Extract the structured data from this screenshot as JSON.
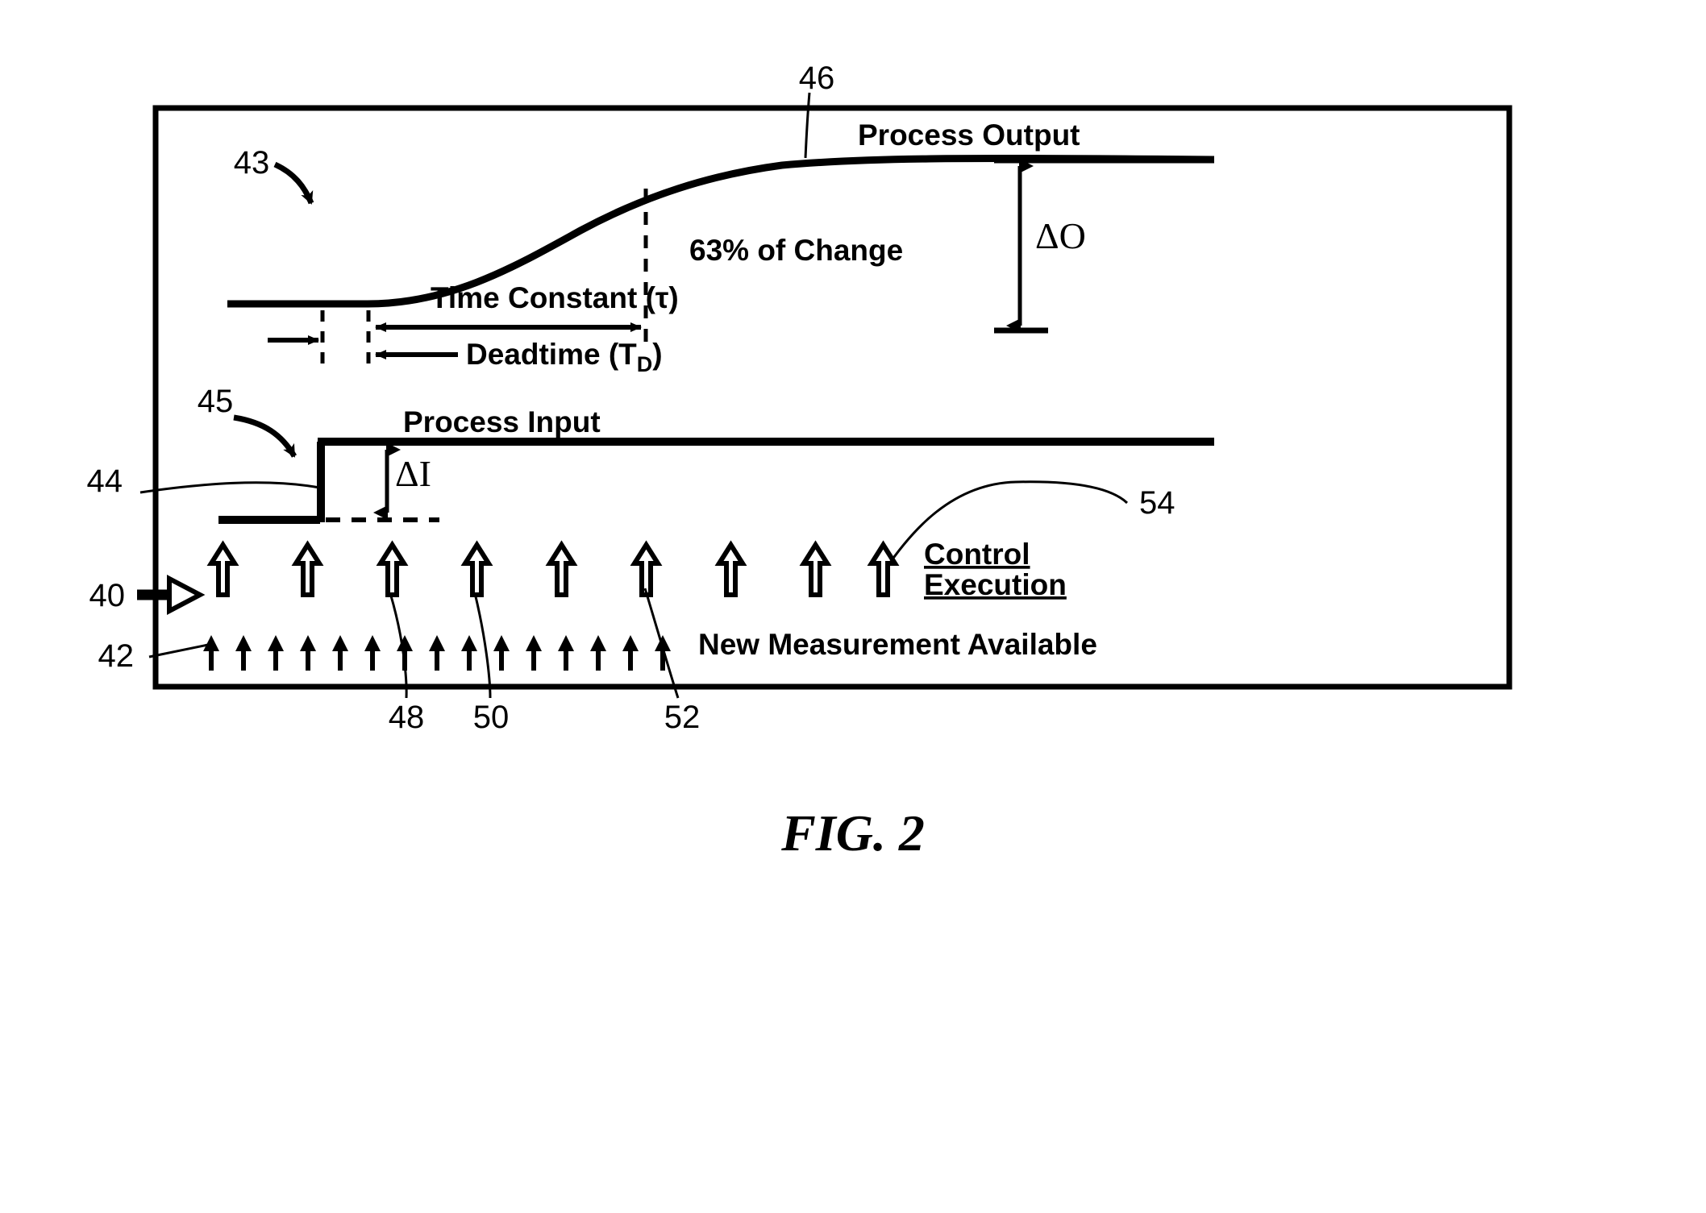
{
  "figure": {
    "caption": "FIG. 2",
    "border_color": "#000000",
    "line_color": "#000000",
    "background": "#ffffff"
  },
  "labels": {
    "process_output": "Process Output",
    "process_input": "Process Input",
    "percent_of_change": "63% of Change",
    "time_constant": "Time Constant (τ)",
    "deadtime": "Deadtime (T",
    "deadtime_sub": "D",
    "deadtime_close": ")",
    "delta_output": "ΔO",
    "delta_input": "ΔI",
    "control_execution_line1": "Control",
    "control_execution_line2": "Execution",
    "new_measurement": "New Measurement Available"
  },
  "reference_numerals": {
    "n40": "40",
    "n42": "42",
    "n43": "43",
    "n44": "44",
    "n45": "45",
    "n46": "46",
    "n48": "48",
    "n50": "50",
    "n52": "52",
    "n54": "54"
  },
  "chart_data": {
    "type": "line",
    "title": "FIG. 2 — Process step response timing diagram",
    "xlabel": "",
    "ylabel": "",
    "grid": false,
    "legend": "none",
    "annotations": [
      "Process Output",
      "Process Input",
      "63% of Change",
      "Time Constant (τ)",
      "Deadtime (T_D)",
      "ΔO",
      "ΔI",
      "Control Execution",
      "New Measurement Available"
    ],
    "series": [
      {
        "name": "Process Output",
        "description": "Flat baseline, then first-order exponential rise to a new steady state after the deadtime; reaches 63% of total change at one time constant after the deadtime.",
        "x": [
          0,
          0.22,
          0.3,
          0.36,
          0.44,
          0.52,
          0.6,
          0.68,
          0.76,
          0.84,
          1.0
        ],
        "y": [
          0,
          0,
          0,
          0.18,
          0.4,
          0.58,
          0.72,
          0.83,
          0.91,
          0.96,
          1.0
        ]
      },
      {
        "name": "Process Input",
        "description": "Step change from low level to high level at the step time.",
        "x": [
          0,
          0.16,
          0.16,
          1.0
        ],
        "y": [
          0,
          0,
          1,
          1
        ]
      }
    ],
    "markers": {
      "step_time": 0.16,
      "response_start_time": 0.3,
      "time_constant_end": 0.63,
      "percent_at_time_constant": 63,
      "delta_output_label": "ΔO",
      "delta_input_label": "ΔI"
    },
    "event_rows": [
      {
        "name": "Control Execution",
        "marker": "hollow-up-arrow",
        "count": 9,
        "description": "Evenly spaced large hollow up-arrows indicating control execution instants"
      },
      {
        "name": "New Measurement Available",
        "marker": "solid-up-arrow",
        "count": 15,
        "description": "Evenly spaced small solid up-arrows indicating new measurement instants"
      }
    ]
  }
}
